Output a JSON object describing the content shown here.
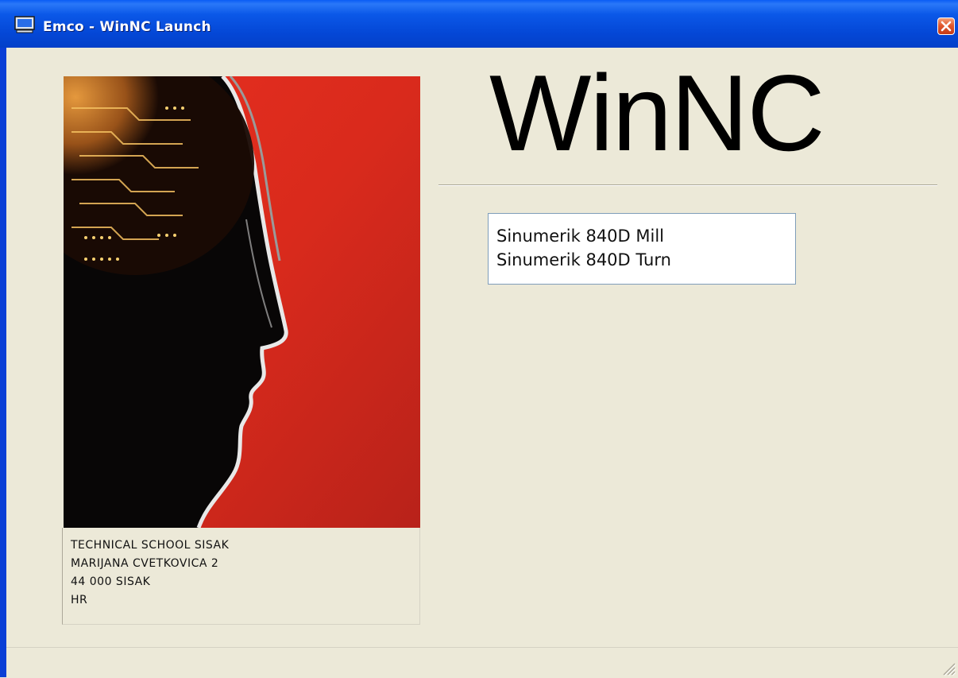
{
  "window": {
    "title": "Emco - WinNC Launch",
    "icon": "computer-icon",
    "close_icon": "close-icon"
  },
  "brand": {
    "text": "WinNC"
  },
  "splash": {
    "image": "head-with-circuit-brain"
  },
  "address": {
    "lines": [
      "TECHNICAL SCHOOL SISAK",
      "MARIJANA CVETKOVICA 2",
      "44 000   SISAK",
      "HR"
    ]
  },
  "control_list": {
    "items": [
      "Sinumerik 840D Mill",
      "Sinumerik 840D Turn"
    ]
  },
  "colors": {
    "titlebar": "#0447d6",
    "window_bg": "#ece9d8",
    "close_button": "#e1582e",
    "splash_red": "#d92a1c",
    "circuit_gold": "#d98a2a"
  }
}
